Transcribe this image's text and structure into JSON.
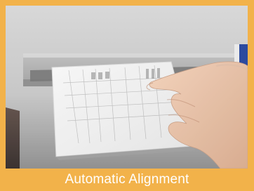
{
  "caption": {
    "text": "Automatic Alignment"
  },
  "colors": {
    "frame": "#f2b24a",
    "caption_text": "#ffffff",
    "accent_edge": "#1f3f9a"
  },
  "photo": {
    "subject_icon": "hand-inserting-card-icon"
  }
}
